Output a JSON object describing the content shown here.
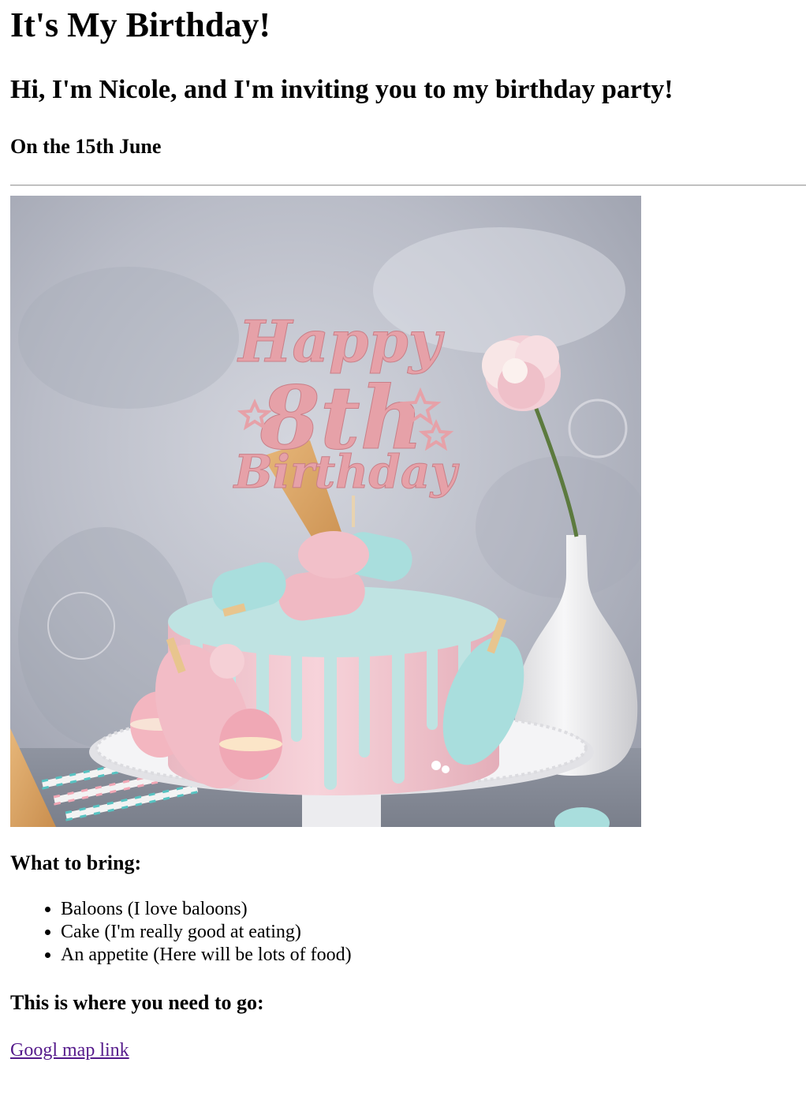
{
  "page": {
    "title": "It's My Birthday!",
    "subtitle": "Hi, I'm Nicole, and I'm inviting you to my birthday party!",
    "date": "On the 15th June"
  },
  "image": {
    "topper_line1": "Happy",
    "topper_number": "8th",
    "topper_line2": "Birthday"
  },
  "bring": {
    "heading": "What to bring:",
    "items": [
      "Baloons (I love baloons)",
      "Cake (I'm really good at eating)",
      "An appetite (Here will be lots of food)"
    ]
  },
  "location": {
    "heading": "This is where you need to go:",
    "link_label": "Googl map link"
  },
  "colors": {
    "link_visited": "#551a8b",
    "cake_pink": "#f4c8d0",
    "drip_blue": "#bfe3e2",
    "topper_rose": "#e8a0a8"
  }
}
